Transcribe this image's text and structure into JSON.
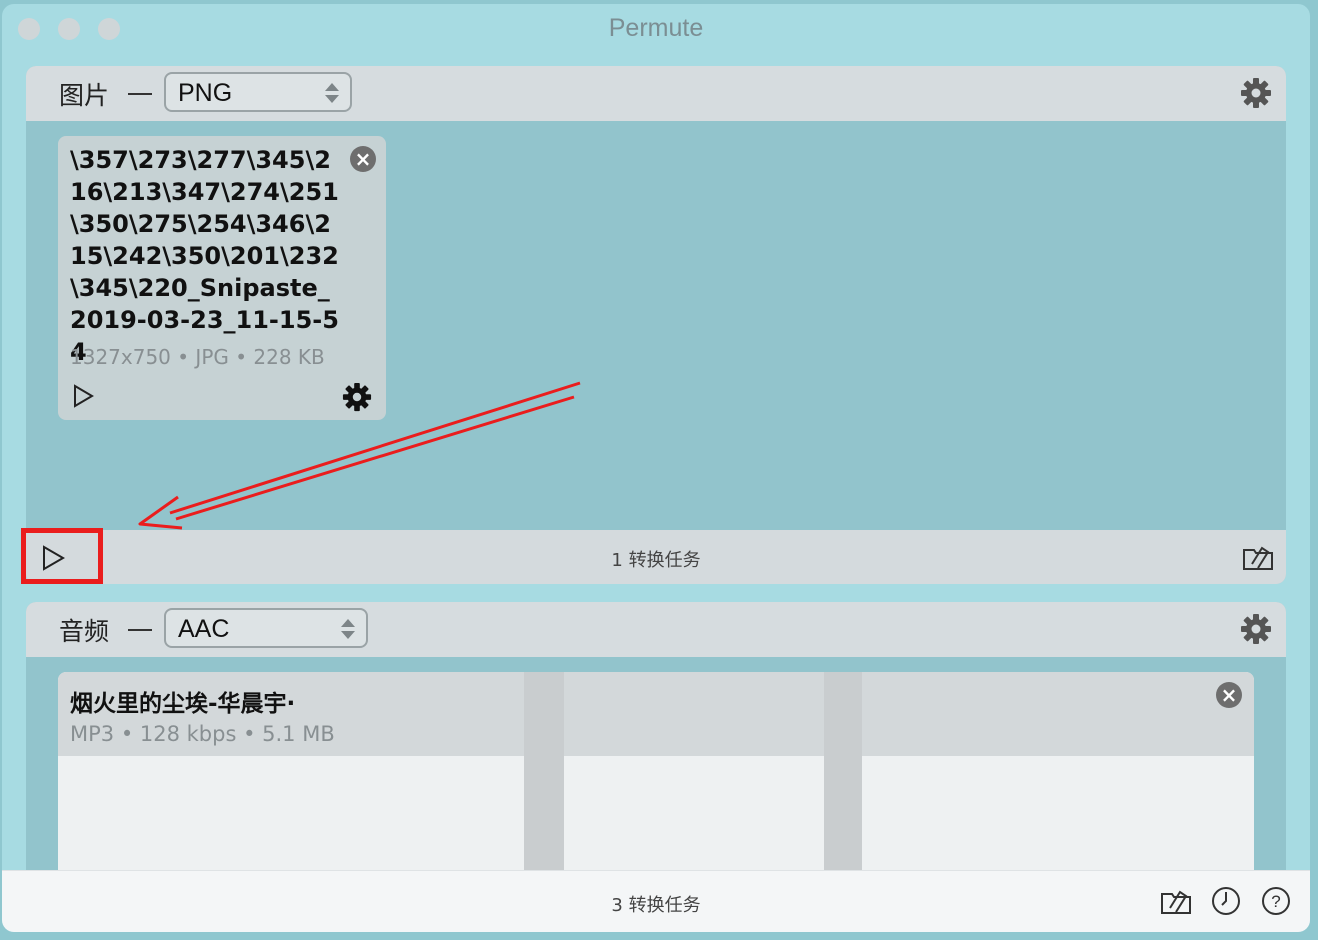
{
  "window": {
    "title": "Permute"
  },
  "image_panel": {
    "label": "图片",
    "format": "PNG",
    "file": {
      "name": "\\357\\273\\277\\345\\216\\213\\347\\274\\251\\350\\275\\254\\346\\215\\242\\350\\201\\232\\345\\220_Snipaste_2019-03-23_11-15-54",
      "meta": "1327x750 • JPG • 228 KB"
    },
    "task_count": "1 转换任务"
  },
  "audio_panel": {
    "label": "音频",
    "format": "AAC",
    "file": {
      "name": "烟火里的尘埃-华晨宇·",
      "meta": "MP3 • 128 kbps • 5.1 MB"
    }
  },
  "footer": {
    "task_count": "3 转换任务"
  },
  "icons": {
    "gear": "gear-icon",
    "play": "play-icon",
    "close": "close-icon",
    "folder": "folder-icon",
    "history": "clock-icon",
    "help": "help-icon"
  },
  "colors": {
    "highlight": "#ea1d1d",
    "window_bg": "#a7dbe2"
  }
}
